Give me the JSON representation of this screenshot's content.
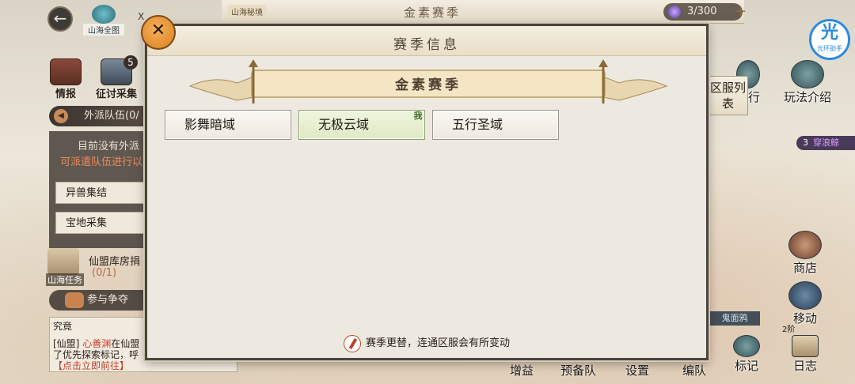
{
  "top": {
    "season_banner": "金素赛季",
    "region_tag": "山海秘境",
    "stamina": "3/300",
    "map_label": "山海全图",
    "map_close": "X"
  },
  "left": {
    "intel_label": "情报",
    "expedition_label": "征讨采集",
    "expedition_badge": "5",
    "team_header": "外派队伍(0/",
    "team_empty_line1": "目前没有外派",
    "team_empty_line2": "可派遣队伍进行以",
    "option_1": "异兽集结",
    "option_2": "宝地采集",
    "task_label": "山海任务",
    "task_title": "仙盟库房捐",
    "task_progress": "(0/1)",
    "contest_label": "参与争夺"
  },
  "chat": {
    "tab": "究竟",
    "line1_prefix": "[仙盟] ",
    "line1_name": "心善渊",
    "line1_rest": "在仙盟",
    "line2": "了优先探索标记，呼",
    "line3": "【点击立即前往】"
  },
  "right": {
    "rank_label": "排行",
    "gameplay_label": "玩法介绍",
    "server_list_label": "区服列表",
    "chuan_num": "3",
    "chuan_text": "穿浪鲸",
    "shop_label": "商店",
    "monster_label": "鬼面鸦",
    "move_label": "移动",
    "move_cost": "2阶",
    "mark_label": "标记",
    "log_label": "日志",
    "assistant_glyph": "光",
    "assistant_text": "光环助手"
  },
  "bottom_tabs": [
    "增益",
    "预备队",
    "设置",
    "编队"
  ],
  "modal": {
    "title": "赛季信息",
    "season_name": "金素赛季",
    "regions": [
      {
        "name": "影舞暗域",
        "active": false
      },
      {
        "name": "无极云域",
        "active": true,
        "tag": "我"
      },
      {
        "name": "五行圣域",
        "active": false
      }
    ],
    "footer": "赛季更替，连通区服会有所变动"
  }
}
